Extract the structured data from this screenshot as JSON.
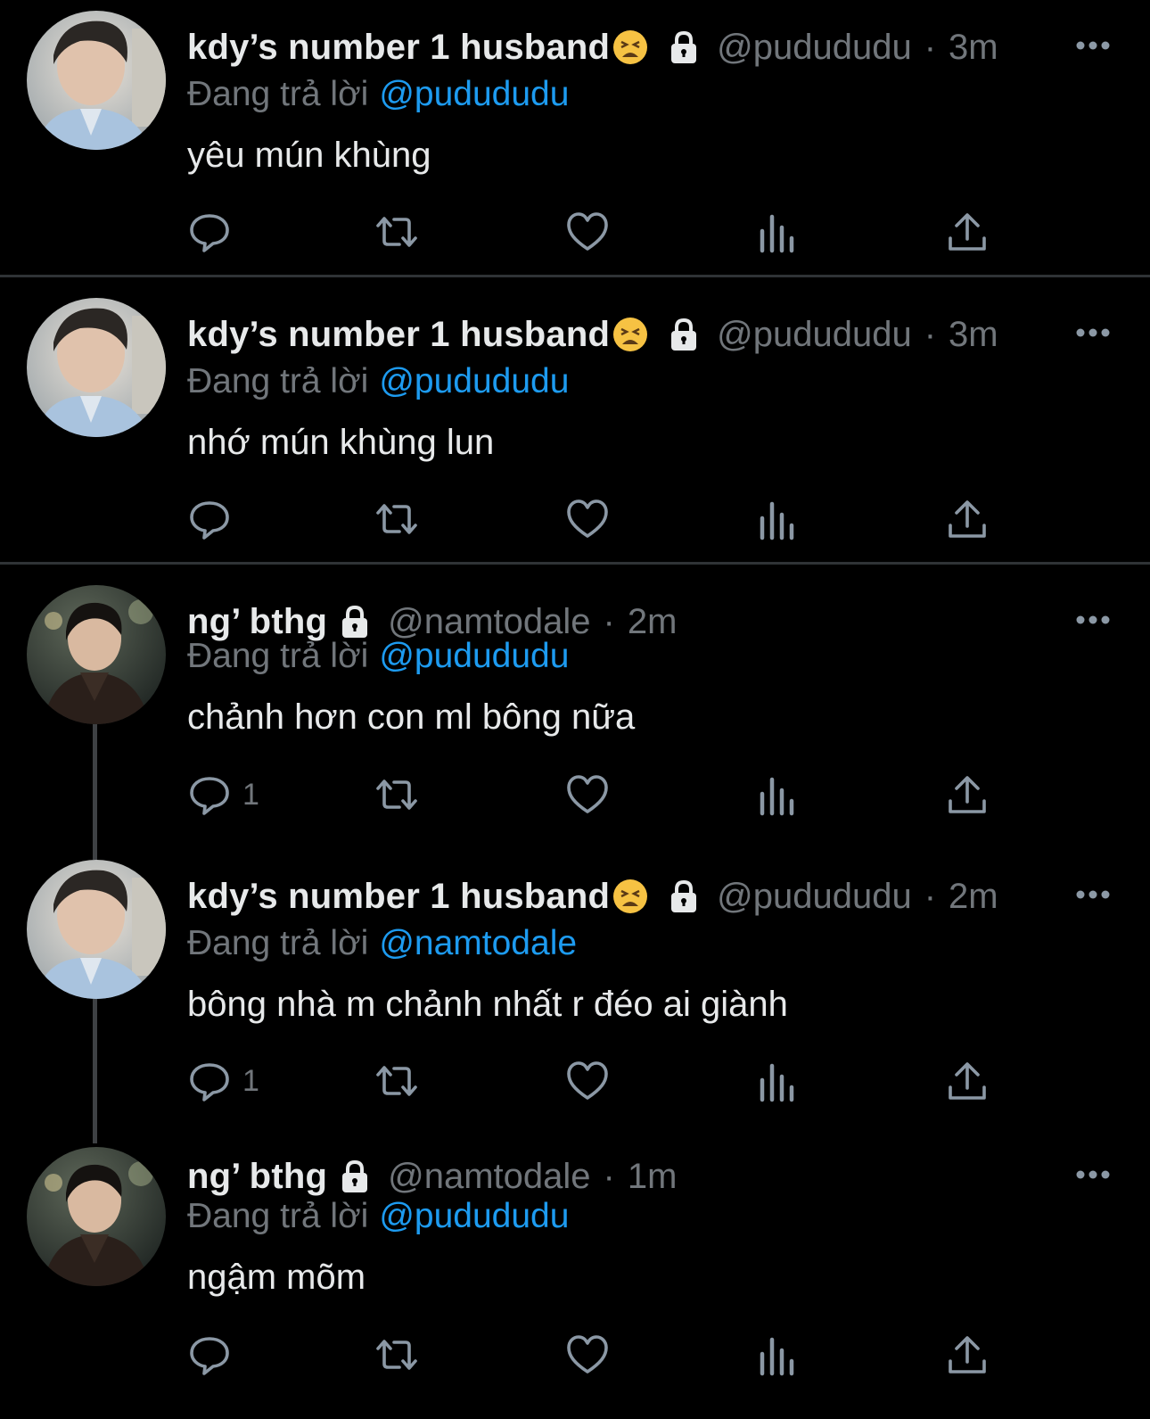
{
  "tweets": [
    {
      "name": "kdy’s number 1 husband",
      "handle": "@pudududu",
      "separator": "·",
      "time": "3m",
      "reply_prefix": "Đang trả lời",
      "reply_to": "@pudududu",
      "text": "yêu mún khùng",
      "reply_count": "",
      "avatar": "avatar-man-light-shirt",
      "has_emoji": true
    },
    {
      "name": "kdy’s number 1 husband",
      "handle": "@pudududu",
      "separator": "·",
      "time": "3m",
      "reply_prefix": "Đang trả lời",
      "reply_to": "@pudududu",
      "text": "nhớ mún khùng lun",
      "reply_count": "",
      "avatar": "avatar-man-light-shirt",
      "has_emoji": true
    },
    {
      "name": "ng’ bthg",
      "handle": "@namtodale",
      "separator": "·",
      "time": "2m",
      "reply_prefix": "Đang trả lời",
      "reply_to": "@pudududu",
      "text": "chảnh hơn con ml bông nữa",
      "reply_count": "1",
      "avatar": "avatar-man-dark-jacket",
      "has_emoji": false
    },
    {
      "name": "kdy’s number 1 husband",
      "handle": "@pudududu",
      "separator": "·",
      "time": "2m",
      "reply_prefix": "Đang trả lời",
      "reply_to": "@namtodale",
      "text": "bông nhà m chảnh nhất r đéo ai giành",
      "reply_count": "1",
      "avatar": "avatar-man-light-shirt",
      "has_emoji": true
    },
    {
      "name": "ng’ bthg",
      "handle": "@namtodale",
      "separator": "·",
      "time": "1m",
      "reply_prefix": "Đang trả lời",
      "reply_to": "@pudududu",
      "text": "ngậm mõm",
      "reply_count": "",
      "avatar": "avatar-man-dark-jacket",
      "has_emoji": false
    }
  ],
  "icons": {
    "reply": "reply-icon",
    "retweet": "retweet-icon",
    "like": "heart-icon",
    "views": "views-icon",
    "share": "share-icon",
    "protected": "lock-icon",
    "more": "more-icon",
    "emoji": "weary-face-emoji"
  },
  "colors": {
    "background": "#000000",
    "text": "#e7e9ea",
    "muted": "#71767b",
    "link": "#1d9bf0",
    "divider": "#2f3336"
  }
}
